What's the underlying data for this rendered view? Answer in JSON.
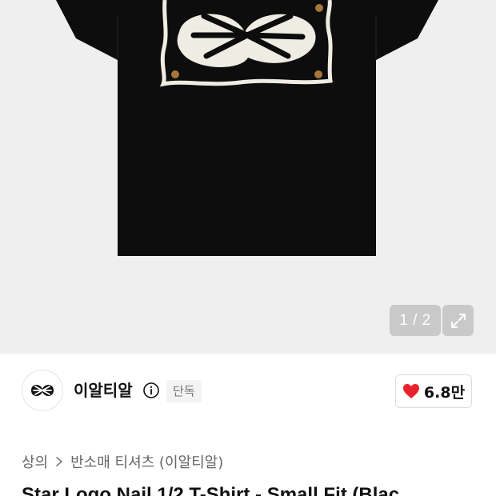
{
  "product_image": {
    "page_indicator": "1 / 2",
    "expand_icon": "expand-arrows-icon"
  },
  "brand": {
    "name": "이알티알",
    "info_icon": "info-icon",
    "badge": "단독"
  },
  "like": {
    "icon": "heart-icon",
    "color": "#e8232b",
    "count": "6.8만"
  },
  "breadcrumb": {
    "category": "상의",
    "separator_icon": "chevron-right-icon",
    "subcategory": "반소매 티셔츠 (이알티알)"
  },
  "product": {
    "title": "Star Logo Nail 1/2 T-Shirt - Small Fit (Blac"
  }
}
